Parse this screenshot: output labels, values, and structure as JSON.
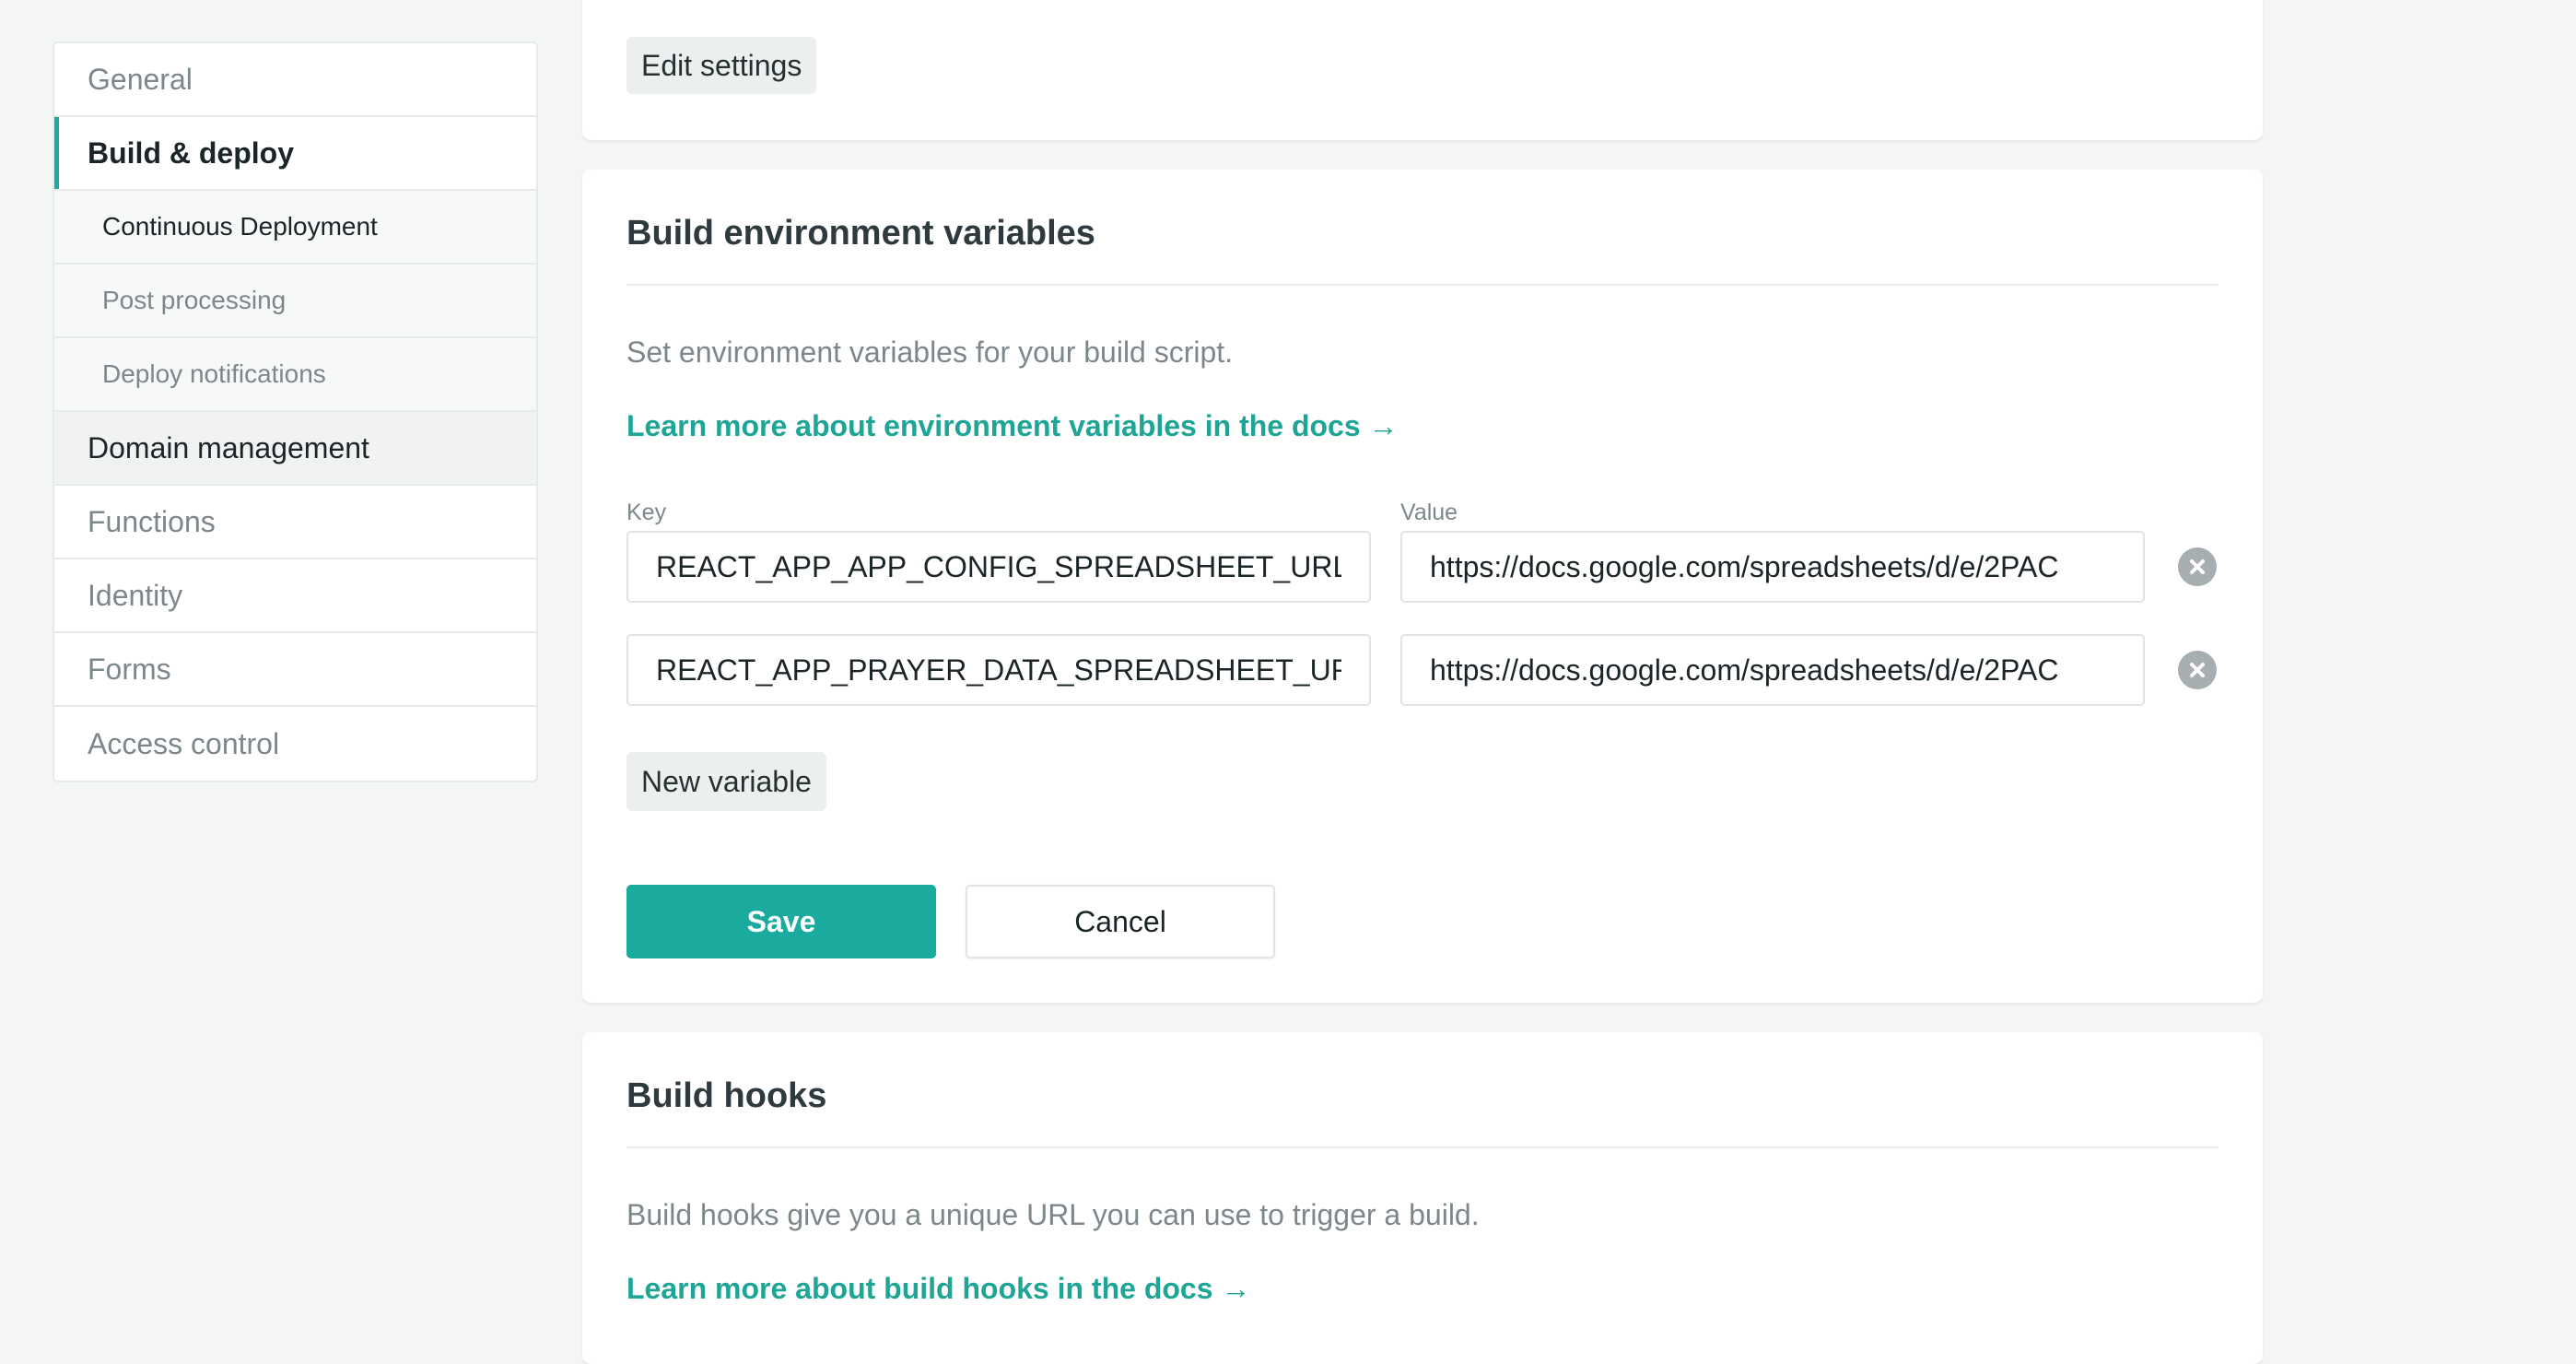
{
  "sidebar": {
    "items": [
      {
        "label": "General"
      },
      {
        "label": "Build & deploy"
      },
      {
        "label": "Continuous Deployment"
      },
      {
        "label": "Post processing"
      },
      {
        "label": "Deploy notifications"
      },
      {
        "label": "Domain management"
      },
      {
        "label": "Functions"
      },
      {
        "label": "Identity"
      },
      {
        "label": "Forms"
      },
      {
        "label": "Access control"
      }
    ]
  },
  "top_card": {
    "edit_settings_label": "Edit settings"
  },
  "env_card": {
    "title": "Build environment variables",
    "description": "Set environment variables for your build script.",
    "docs_link": "Learn more about environment variables in the docs →",
    "key_label": "Key",
    "value_label": "Value",
    "variables": [
      {
        "key": "REACT_APP_APP_CONFIG_SPREADSHEET_URL",
        "value": "https://docs.google.com/spreadsheets/d/e/2PAC"
      },
      {
        "key": "REACT_APP_PRAYER_DATA_SPREADSHEET_URL",
        "value": "https://docs.google.com/spreadsheets/d/e/2PAC"
      }
    ],
    "new_variable_label": "New variable",
    "save_label": "Save",
    "cancel_label": "Cancel"
  },
  "hooks_card": {
    "title": "Build hooks",
    "description": "Build hooks give you a unique URL you can use to trigger a build.",
    "docs_link": "Learn more about build hooks in the docs →"
  },
  "colors": {
    "accent": "#1bab9e",
    "link": "#1ea596",
    "background": "#f4f6f6"
  },
  "icons": {
    "remove": "close-circle-icon"
  }
}
